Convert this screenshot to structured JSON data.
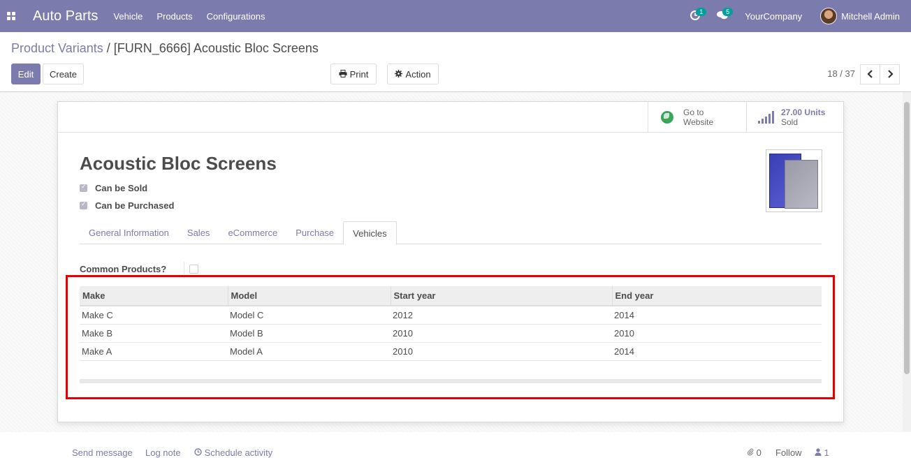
{
  "navbar": {
    "app_title": "Auto Parts",
    "menu": [
      "Vehicle",
      "Products",
      "Configurations"
    ],
    "activity_badge": "1",
    "messages_badge": "5",
    "company": "YourCompany",
    "user_name": "Mitchell Admin"
  },
  "breadcrumb": {
    "parent": "Product Variants",
    "separator": "/",
    "current": "[FURN_6666] Acoustic Bloc Screens"
  },
  "toolbar": {
    "edit_label": "Edit",
    "create_label": "Create",
    "print_label": "Print",
    "action_label": "Action"
  },
  "pager": {
    "value": "18 / 37"
  },
  "stat_buttons": {
    "website_line1": "Go to",
    "website_line2": "Website",
    "sold_value": "27.00 Units",
    "sold_label": "Sold"
  },
  "product": {
    "name": "Acoustic Bloc Screens",
    "can_be_sold_label": "Can be Sold",
    "can_be_sold": true,
    "can_be_purchased_label": "Can be Purchased",
    "can_be_purchased": true
  },
  "tabs": [
    {
      "label": "General Information",
      "active": false
    },
    {
      "label": "Sales",
      "active": false
    },
    {
      "label": "eCommerce",
      "active": false
    },
    {
      "label": "Purchase",
      "active": false
    },
    {
      "label": "Vehicles",
      "active": true
    }
  ],
  "vehicles_tab": {
    "common_products_label": "Common Products?",
    "common_products": false,
    "columns": [
      "Make",
      "Model",
      "Start year",
      "End year"
    ],
    "rows": [
      [
        "Make C",
        "Model C",
        "2012",
        "2014"
      ],
      [
        "Make B",
        "Model B",
        "2010",
        "2010"
      ],
      [
        "Make A",
        "Model A",
        "2010",
        "2014"
      ]
    ]
  },
  "chatter": {
    "send_message": "Send message",
    "log_note": "Log note",
    "schedule_activity": "Schedule activity",
    "attachments_count": "0",
    "follow_label": "Follow",
    "followers_count": "1"
  },
  "colors": {
    "brand": "#7c7bad",
    "highlight": "#e30000"
  }
}
